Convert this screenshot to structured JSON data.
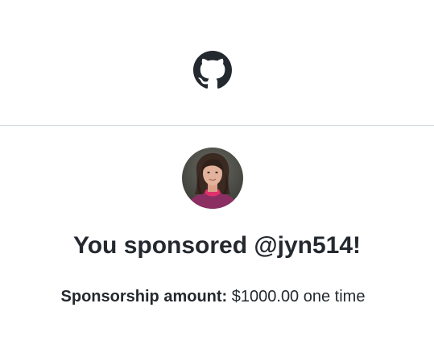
{
  "header": {
    "logo_icon": "github-octocat-icon"
  },
  "sponsor": {
    "avatar_icon": "user-avatar-photo",
    "title": "You sponsored @jyn514!",
    "amount_label": "Sponsorship amount:",
    "amount_value": "$1000.00",
    "frequency": "one time"
  },
  "colors": {
    "text": "#24292f",
    "divider": "#d0d7de",
    "background": "#ffffff"
  }
}
